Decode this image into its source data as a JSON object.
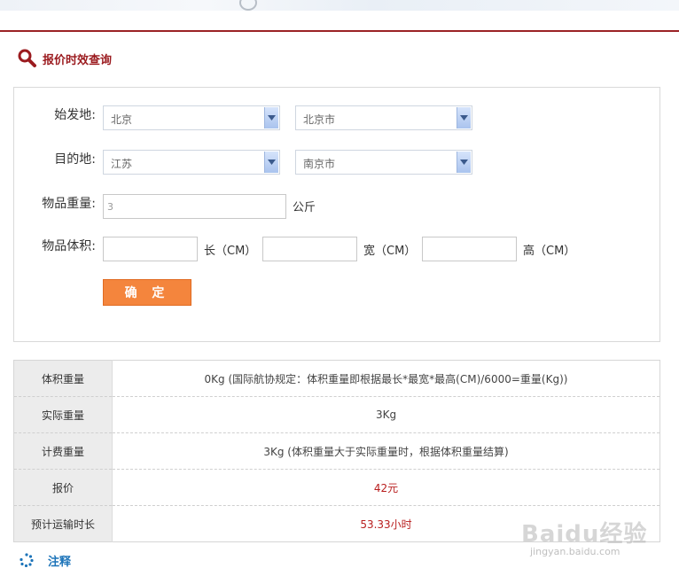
{
  "section_title": "报价时效查询",
  "form": {
    "origin_label": "始发地:",
    "origin_province": "北京",
    "origin_city": "北京市",
    "destination_label": "目的地:",
    "destination_province": "江苏",
    "destination_city": "南京市",
    "weight_label": "物品重量:",
    "weight_value": "3",
    "weight_unit": "公斤",
    "volume_label": "物品体积:",
    "length_unit": "长（CM）",
    "width_unit": "宽（CM）",
    "height_unit": "高（CM）",
    "confirm_label": "确 定"
  },
  "results": [
    {
      "key": "体积重量",
      "value": "0Kg (国际航协规定：体积重量即根据最长*最宽*最高(CM)/6000=重量(Kg))"
    },
    {
      "key": "实际重量",
      "value": "3Kg"
    },
    {
      "key": "计费重量",
      "value": "3Kg (体积重量大于实际重量时，根据体积重量结算)"
    },
    {
      "key": "报价",
      "value": "42元"
    },
    {
      "key": "预计运输时长",
      "value": "53.33小时"
    }
  ],
  "notes_label": "注释",
  "watermark": {
    "brand": "Baidu经验",
    "url": "jingyan.baidu.com"
  },
  "colors": {
    "accent_red": "#9b1b1f",
    "button_orange": "#f4853d",
    "link_blue": "#1d74b9",
    "price_red": "#b81d1d"
  },
  "icons": {
    "title": "search-icon",
    "notes": "loading-dots-icon",
    "dropdown": "chevron-down-icon"
  }
}
